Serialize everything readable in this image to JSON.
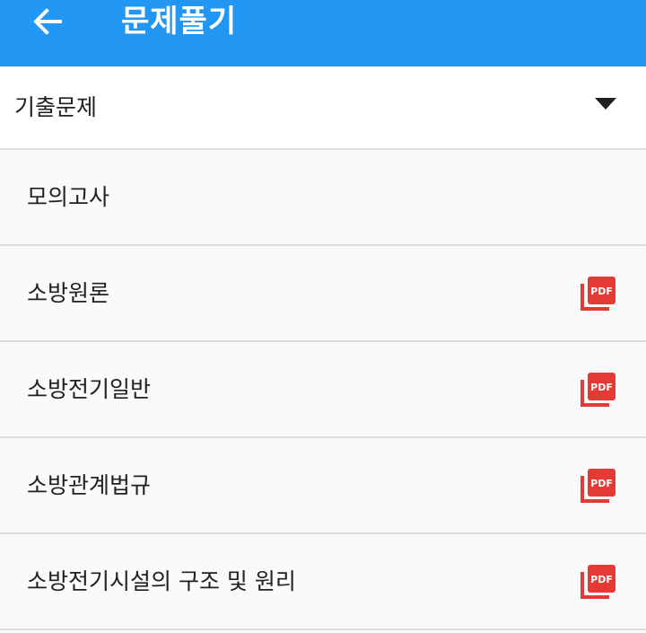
{
  "appbar": {
    "title": "문제풀기",
    "back_icon": "arrow-left-icon"
  },
  "dropdown": {
    "selected": "기출문제",
    "caret_icon": "caret-down-icon"
  },
  "items": [
    {
      "label": "모의고사",
      "has_pdf": false
    },
    {
      "label": "소방원론",
      "has_pdf": true
    },
    {
      "label": "소방전기일반",
      "has_pdf": true
    },
    {
      "label": "소방관계법규",
      "has_pdf": true
    },
    {
      "label": "소방전기시설의 구조 및 원리",
      "has_pdf": true
    }
  ],
  "pdf_icon_text": "PDF",
  "colors": {
    "appbar": "#2196f3",
    "pdf_red": "#e53935",
    "divider": "#dcdcdc"
  }
}
